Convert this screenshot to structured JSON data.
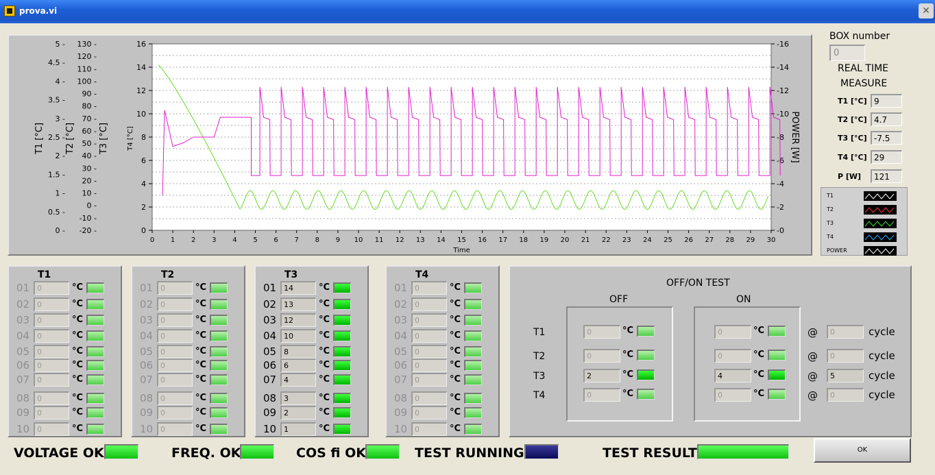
{
  "window": {
    "title": "prova.vi"
  },
  "graph": {
    "xlabel": "Time",
    "x_ticks": [
      "0",
      "1",
      "2",
      "3",
      "4",
      "5",
      "6",
      "7",
      "8",
      "9",
      "10",
      "11",
      "12",
      "13",
      "14",
      "15",
      "16",
      "17",
      "18",
      "19",
      "20",
      "21",
      "22",
      "23",
      "24",
      "25",
      "26",
      "27",
      "28",
      "29",
      "30"
    ],
    "y_t4_ticks": [
      "16",
      "14",
      "12",
      "10",
      "8",
      "6",
      "4",
      "2",
      "0"
    ],
    "y_t4_label": "T4 [°C]",
    "y_t3_ticks": [
      "130",
      "120",
      "110",
      "100",
      "90",
      "80",
      "70",
      "60",
      "50",
      "40",
      "30",
      "20",
      "10",
      "0",
      "-10",
      "-20"
    ],
    "y_t3_label": "T3 [°C]",
    "y_t2_label": "T2 [°C]",
    "y_t1_ticks": [
      "5",
      "4.5",
      "4",
      "3.5",
      "3",
      "2.5",
      "2",
      "1.5",
      "1",
      "0.5",
      "0"
    ],
    "y_t1_label": "T1 [°C]",
    "y_power_ticks": [
      "16",
      "14",
      "12",
      "10",
      "8",
      "6",
      "4",
      "2",
      "0"
    ],
    "y_power_label": "POWER [W]"
  },
  "chart_data": {
    "type": "line",
    "xlabel": "Time",
    "ylabel": "T4 [°C]",
    "ylabel_right": "POWER [W]",
    "xlim": [
      0,
      30
    ],
    "ylim": [
      0,
      16
    ],
    "grid": true,
    "series": [
      {
        "name": "T3",
        "color": "#66dd22",
        "decay_to": 2.0,
        "start": 14.2,
        "osc_center": 2.6,
        "osc_amplitude": 0.8,
        "osc_period": 1.1
      },
      {
        "name": "POWER",
        "color": "#e020d0",
        "low": 4.7,
        "high": 12.3,
        "initial": [
          [
            0.5,
            3
          ],
          [
            0.6,
            10.3
          ],
          [
            1,
            7.2
          ],
          [
            1.5,
            7.5
          ],
          [
            2,
            8
          ],
          [
            3,
            8
          ],
          [
            3.3,
            9.7
          ],
          [
            4.8,
            9.7
          ]
        ]
      }
    ]
  },
  "box": {
    "label": "BOX number",
    "value": "0"
  },
  "realtime": {
    "title_line1": "REAL TIME",
    "title_line2": "MEASURE",
    "items": [
      {
        "label": "T1 [°C]",
        "value": "9"
      },
      {
        "label": "T2 [°C]",
        "value": "4.7"
      },
      {
        "label": "T3 [°C]",
        "value": "-7.5"
      },
      {
        "label": "T4 [°C]",
        "value": "29"
      },
      {
        "label": "P [W]",
        "value": "121"
      }
    ]
  },
  "legend": [
    {
      "name": "T1",
      "color": "#ffffff"
    },
    {
      "name": "T2",
      "color": "#ff3030"
    },
    {
      "name": "T3",
      "color": "#30e030"
    },
    {
      "name": "T4",
      "color": "#20b0ff"
    },
    {
      "name": "POWER",
      "color": "#ffffff"
    }
  ],
  "unit": "°C",
  "groups": [
    {
      "title": "T1",
      "rows": [
        "01",
        "02",
        "03",
        "04",
        "05",
        "06",
        "07",
        "08",
        "09",
        "10"
      ],
      "values": [
        "0",
        "0",
        "0",
        "0",
        "0",
        "0",
        "0",
        "0",
        "0",
        "0"
      ]
    },
    {
      "title": "T2",
      "rows": [
        "01",
        "02",
        "03",
        "04",
        "05",
        "06",
        "07",
        "08",
        "09",
        "10"
      ],
      "values": [
        "0",
        "0",
        "0",
        "0",
        "0",
        "0",
        "0",
        "0",
        "0",
        "0"
      ]
    },
    {
      "title": "T3",
      "rows": [
        "01",
        "02",
        "03",
        "04",
        "05",
        "06",
        "07",
        "08",
        "09",
        "10"
      ],
      "values": [
        "14",
        "13",
        "12",
        "10",
        "8",
        "6",
        "4",
        "3",
        "2",
        "1"
      ]
    },
    {
      "title": "T4",
      "rows": [
        "01",
        "02",
        "03",
        "04",
        "05",
        "06",
        "07",
        "08",
        "09",
        "10"
      ],
      "values": [
        "0",
        "0",
        "0",
        "0",
        "0",
        "0",
        "0",
        "0",
        "0",
        "0"
      ]
    }
  ],
  "offon": {
    "title": "OFF/ON TEST",
    "off_label": "OFF",
    "on_label": "ON",
    "at": "@",
    "cycle": "cycle",
    "rows": [
      {
        "label": "T1",
        "off": "0",
        "on": "0",
        "cycle": "0"
      },
      {
        "label": "T2",
        "off": "0",
        "on": "0",
        "cycle": "0"
      },
      {
        "label": "T3",
        "off": "2",
        "on": "4",
        "cycle": "5"
      },
      {
        "label": "T4",
        "off": "0",
        "on": "0",
        "cycle": "0"
      }
    ]
  },
  "status": {
    "voltage": "VOLTAGE OK",
    "freq": "FREQ. OK",
    "cosfi": "COS fi OK",
    "running": "TEST RUNNING",
    "result": "TEST RESULT"
  },
  "ok_button": "OK"
}
